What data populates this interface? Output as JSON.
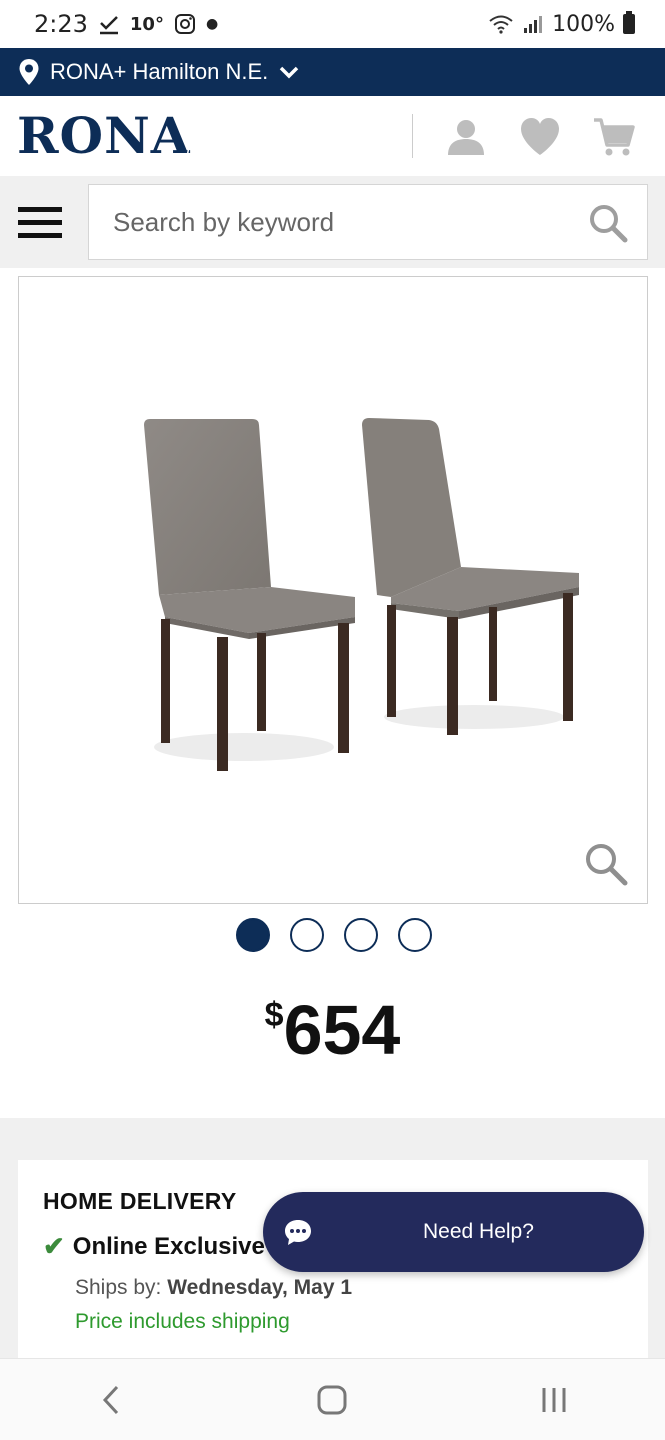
{
  "status_bar": {
    "time": "2:23",
    "temperature": "10°",
    "battery": "100%"
  },
  "store": {
    "name": "RONA+ Hamilton N.E."
  },
  "header": {
    "logo": "RONA",
    "icons": [
      "account-icon",
      "heart-icon",
      "cart-icon"
    ]
  },
  "search": {
    "placeholder": "Search by keyword"
  },
  "product": {
    "image_alt": "Two grey upholstered dining chairs",
    "carousel_total": 4,
    "carousel_active": 1,
    "price_currency": "$",
    "price_amount": "654"
  },
  "delivery": {
    "title": "HOME DELIVERY",
    "badge": "Online Exclusive",
    "ships_label": "Ships by:",
    "ships_date": "Wednesday, May 1",
    "shipping_note": "Price includes shipping"
  },
  "chat": {
    "label": "Need Help?"
  },
  "colors": {
    "brand_navy": "#0d2d57",
    "chat_bg": "#232a5c",
    "success_green": "#2e9a2e"
  }
}
